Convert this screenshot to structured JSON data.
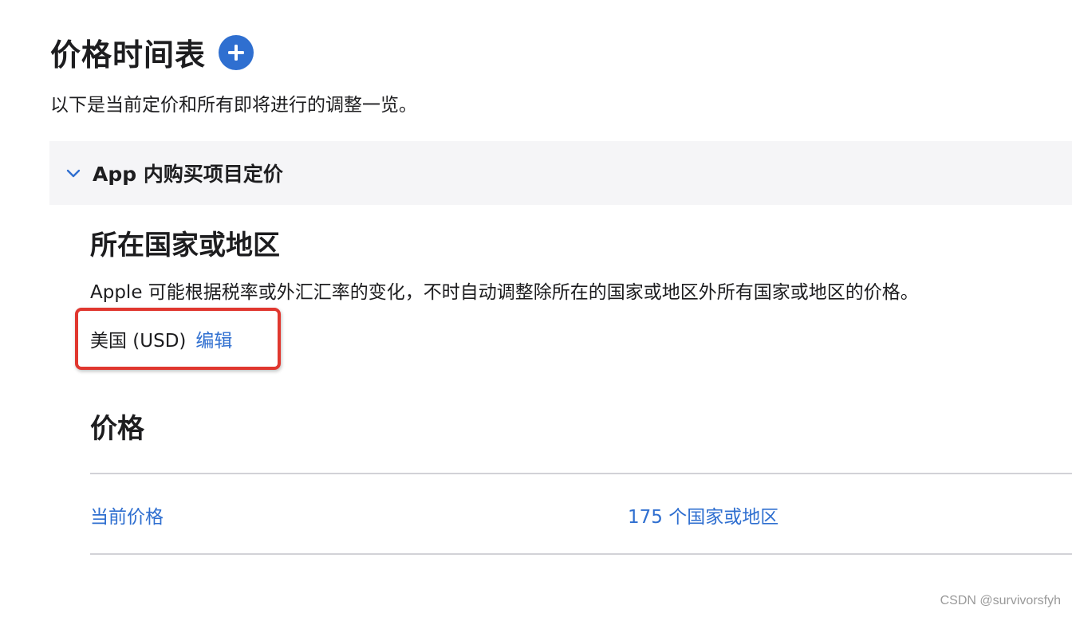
{
  "header": {
    "title": "价格时间表",
    "add_icon": "plus-circle-icon"
  },
  "subtitle": "以下是当前定价和所有即将进行的调整一览。",
  "section": {
    "chevron_icon": "chevron-down-icon",
    "title": "App 内购买项目定价"
  },
  "country": {
    "heading": "所在国家或地区",
    "description": "Apple 可能根据税率或外汇汇率的变化，不时自动调整除所在的国家或地区外所有国家或地区的价格。",
    "value": "美国 (USD)",
    "edit_label": "编辑"
  },
  "price": {
    "heading": "价格",
    "rows": [
      {
        "label": "当前价格",
        "count": "175 个国家或地区"
      }
    ]
  },
  "watermark": "CSDN @survivorsfyh",
  "colors": {
    "accent": "#2f6fd0",
    "highlight": "#e0372f",
    "section_bg": "#f5f5f7"
  }
}
